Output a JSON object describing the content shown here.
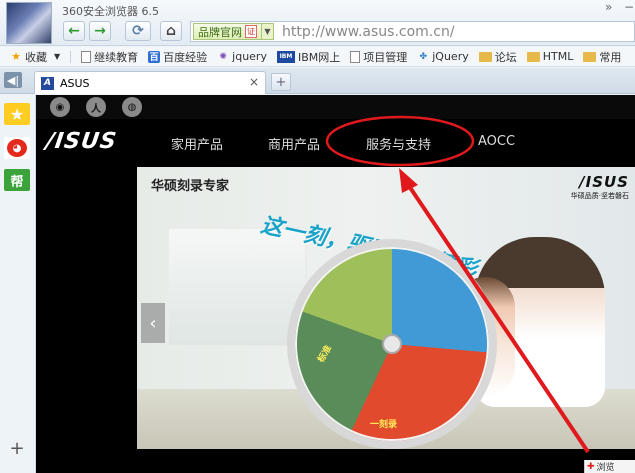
{
  "browser": {
    "title": "360安全浏览器 6.5",
    "title_controls": [
      "»",
      "−"
    ],
    "address_badge": "品牌官网",
    "address_badge_stamp": "证",
    "address_url": "http://www.asus.com.cn/"
  },
  "bookmarks": [
    {
      "label": "收藏",
      "icon": "star-icon",
      "has_menu": true
    },
    {
      "label": "继续教育",
      "icon": "page-icon"
    },
    {
      "label": "百度经验",
      "icon": "baidu-icon"
    },
    {
      "label": "jquery",
      "icon": "jquery-icon"
    },
    {
      "label": "IBM网上",
      "icon": "ibm-icon"
    },
    {
      "label": "项目管理",
      "icon": "page-icon"
    },
    {
      "label": "jQuery",
      "icon": "jquery-icon"
    },
    {
      "label": "论坛",
      "icon": "folder-icon"
    },
    {
      "label": "HTML",
      "icon": "folder-icon"
    },
    {
      "label": "常用",
      "icon": "folder-icon"
    }
  ],
  "tabs": [
    {
      "label": "ASUS",
      "active": true,
      "close": "×"
    }
  ],
  "new_tab_label": "+",
  "sidebar": {
    "favorite_icon": "★",
    "weibo_icon": "微",
    "help_label": "帮",
    "add_label": "+"
  },
  "site": {
    "logo": "/ISUS",
    "nav": [
      "家用产品",
      "商用产品",
      "服务与支持",
      "AOCC"
    ],
    "social_icons": [
      "weibo-icon",
      "user-icon",
      "wechat-icon"
    ],
    "banner": {
      "caption": "华硕刻录专家",
      "slogan": "这一刻，驱动无限精彩",
      "brand_logo": "/ISUS",
      "brand_sub": "华硕品质·坚若磐石",
      "wheel_label_top": "标准",
      "wheel_label_bottom": "一刻录"
    },
    "prev_arrow": "‹"
  },
  "status": {
    "label": "浏览"
  },
  "annotation": {
    "color": "#e0191c",
    "highlighted_item": "服务与支持"
  }
}
